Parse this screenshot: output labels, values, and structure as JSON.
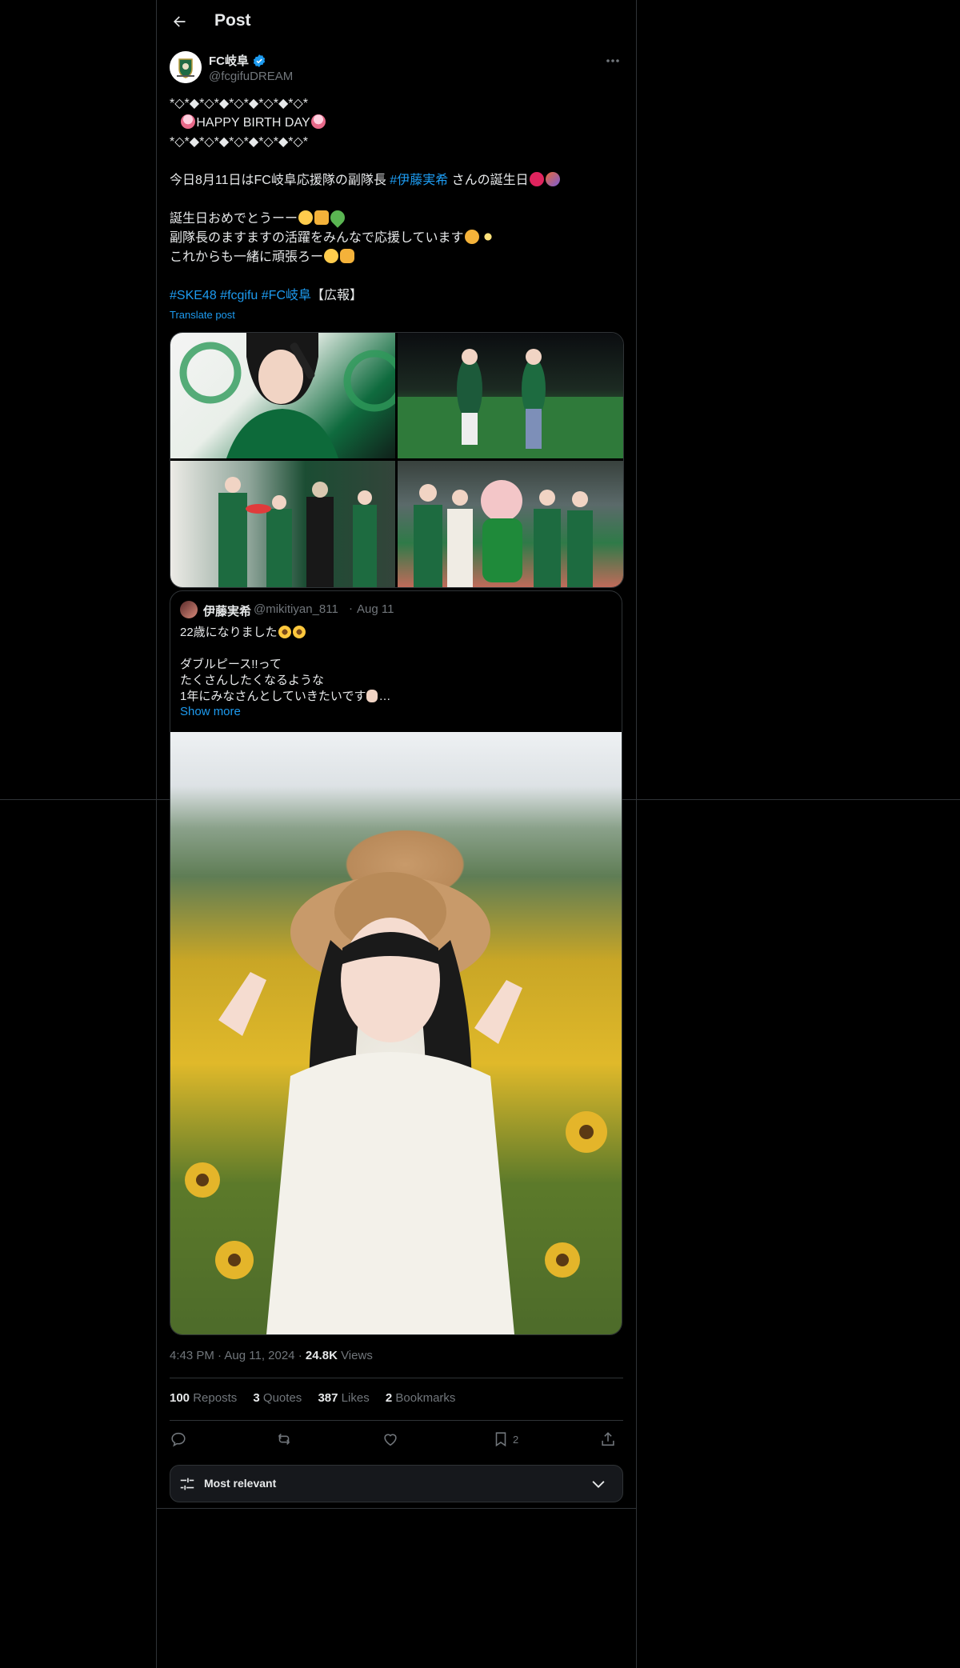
{
  "header": {
    "title": "Post",
    "back_icon": "arrow-left-icon"
  },
  "author": {
    "name": "FC岐阜",
    "handle": "@fcgifuDREAM",
    "verified_color": "#1d9bf0"
  },
  "post": {
    "lines": {
      "l1": "*◇*◆*◇*◆*◇*◆*◇*◆*◇*",
      "l2": "HAPPY BIRTH DAY",
      "l3": "*◇*◆*◇*◆*◇*◆*◇*◆*◇*",
      "l4a": "今日8月11日はFC岐阜応援隊の副隊長 ",
      "l4_tag": "#伊藤実希",
      "l4b": " さんの誕生日",
      "l5": "誕生日おめでとうーー",
      "l6": "副隊長のますますの活躍をみんなで応援しています",
      "l7": "これからも一緒に頑張ろー",
      "tag1": "#SKE48",
      "tag2": "#fcgifu",
      "tag3": "#FC岐阜",
      "tail": "【広報】"
    },
    "translate": "Translate post"
  },
  "quote": {
    "name": "伊藤実希",
    "handle": "@mikitiyan_811",
    "dot": "·",
    "date": "Aug 11",
    "lines": {
      "l1": "22歳になりました",
      "l2": "ダブルピース!!って",
      "l3": "たくさんしたくなるような",
      "l4": "1年にみなさんとしていきたいです",
      "ellipsis": "…"
    },
    "show_more": "Show more"
  },
  "meta": {
    "time": "4:43 PM",
    "dot": "·",
    "date": "Aug 11, 2024",
    "views_count": "24.8K",
    "views_label": "Views"
  },
  "stats": {
    "reposts_count": "100",
    "reposts_label": "Reposts",
    "quotes_count": "3",
    "quotes_label": "Quotes",
    "likes_count": "387",
    "likes_label": "Likes",
    "bookmarks_count": "2",
    "bookmarks_label": "Bookmarks"
  },
  "actions": {
    "reply_icon": "reply-icon",
    "repost_icon": "repost-icon",
    "like_icon": "heart-icon",
    "bookmark_icon": "bookmark-icon",
    "bookmark_count": "2",
    "share_icon": "share-icon"
  },
  "sort": {
    "label": "Most relevant"
  },
  "colors": {
    "accent": "#1d9bf0",
    "muted": "#71767b",
    "border": "#2f3336",
    "bg": "#000000"
  }
}
